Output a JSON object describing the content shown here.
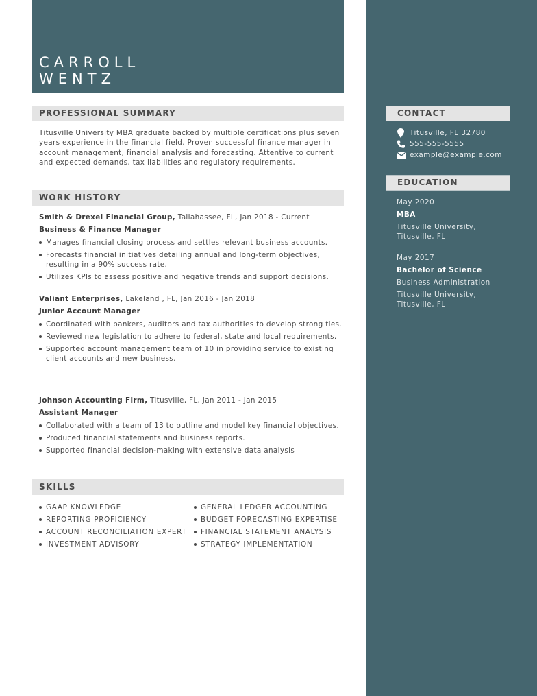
{
  "name": {
    "first": "CARROLL",
    "last": "WENTZ"
  },
  "colors": {
    "accent": "#45666f",
    "section_header_bg": "#e4e4e4",
    "text": "#4a4a4a"
  },
  "summary": {
    "heading": "PROFESSIONAL SUMMARY",
    "text": "Titusville University MBA graduate backed by multiple certifications plus seven years experience in the financial field. Proven successful finance manager in account management, financial analysis and forecasting. Attentive to current and expected demands, tax liabilities and regulatory requirements."
  },
  "work_history": {
    "heading": "WORK HISTORY",
    "jobs": [
      {
        "company": "Smith & Drexel Financial Group,",
        "details": " Tallahassee, FL, Jan 2018 - Current",
        "title": "Business & Finance Manager",
        "bullets": [
          "Manages financial closing process and settles relevant business accounts.",
          "Forecasts financial initiatives detailing annual and long-term objectives, resulting in a 90% success rate.",
          "Utilizes KPIs to assess positive and negative trends and support decisions."
        ]
      },
      {
        "company": "Valiant Enterprises,",
        "details": " Lakeland , FL, Jan 2016 - Jan 2018",
        "title": "Junior Account Manager",
        "bullets": [
          "Coordinated with bankers, auditors and tax authorities to develop strong ties.",
          "Reviewed new legislation to adhere to federal, state and local requirements.",
          "Supported account management team of 10 in providing service to existing client accounts and new business."
        ]
      },
      {
        "company": "Johnson Accounting Firm,",
        "details": " Titusville, FL, Jan 2011 - Jan 2015",
        "title": "Assistant Manager",
        "bullets": [
          "Collaborated with a team of 13 to outline and model key financial objectives.",
          "Produced financial statements and business reports.",
          "Supported financial decision-making with extensive data analysis"
        ]
      }
    ]
  },
  "skills": {
    "heading": "SKILLS",
    "left": [
      "GAAP KNOWLEDGE",
      "REPORTING PROFICIENCY",
      "ACCOUNT RECONCILIATION EXPERT",
      "INVESTMENT ADVISORY"
    ],
    "right": [
      "GENERAL LEDGER ACCOUNTING",
      "BUDGET FORECASTING EXPERTISE",
      "FINANCIAL STATEMENT ANALYSIS",
      "STRATEGY IMPLEMENTATION"
    ]
  },
  "contact": {
    "heading": "CONTACT",
    "items": [
      {
        "icon": "location-pin-icon",
        "text": "Titusville, FL 32780"
      },
      {
        "icon": "phone-icon",
        "text": "555-555-5555"
      },
      {
        "icon": "envelope-icon",
        "text": "example@example.com"
      }
    ]
  },
  "education": {
    "heading": "EDUCATION",
    "entries": [
      {
        "date": "May 2020",
        "degree": "MBA",
        "school_line1": "Titusville University,",
        "school_line2": "Titusville, FL"
      },
      {
        "date": "May 2017",
        "degree": "Bachelor of Science",
        "field": "Business Administration",
        "school_line1": "Titusville University,",
        "school_line2": "Titusville, FL"
      }
    ]
  }
}
